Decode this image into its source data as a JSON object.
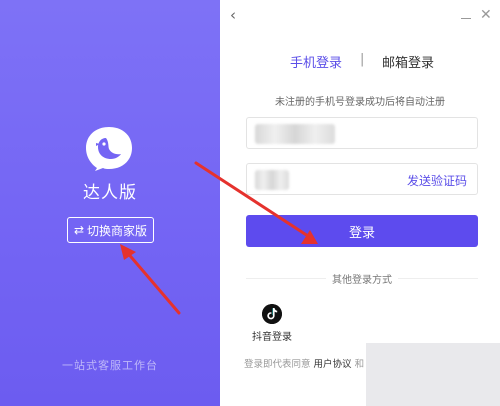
{
  "window": {
    "title": ""
  },
  "left_panel": {
    "brand_title": "达人版",
    "switch_button": {
      "icon": "⇄",
      "label": "切换商家版"
    },
    "footer": "一站式客服工作台",
    "logo_icon": "bird-chat-logo-icon"
  },
  "header": {
    "back_icon": "chevron-left-icon",
    "minimize_icon": "minimize-icon",
    "close_icon": "close-icon"
  },
  "tabs": {
    "phone_login": "手机登录",
    "separator": "|",
    "email_login": "邮箱登录",
    "active": "phone_login"
  },
  "hint": "未注册的手机号登录成功后将自动注册",
  "form": {
    "phone_value": "",
    "code_value": "",
    "send_code": "发送验证码",
    "login_button": "登录"
  },
  "other_login": {
    "title": "其他登录方式",
    "douyin_label": "抖音登录",
    "douyin_icon": "tiktok-icon"
  },
  "agreement": {
    "prefix": "登录即代表同意",
    "link1": "用户协议",
    "and": "和"
  },
  "colors": {
    "accent": "#5d4bee",
    "left_panel": "#7465f4",
    "annotation_arrow": "#e5322d"
  }
}
